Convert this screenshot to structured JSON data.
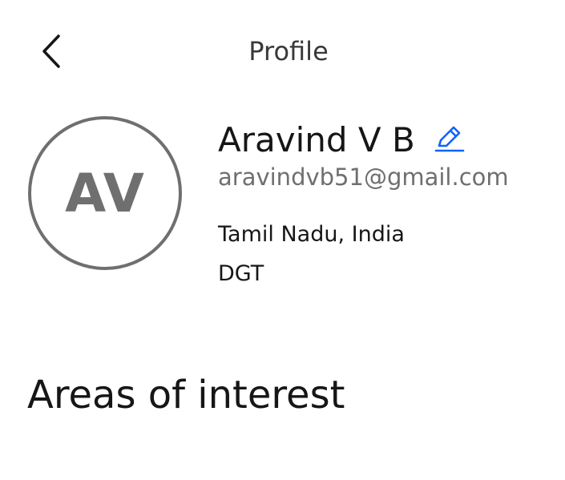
{
  "header": {
    "title": "Profile",
    "back_icon": "chevron-left-icon"
  },
  "profile": {
    "avatar_initials": "AV",
    "name": "Aravind V B",
    "edit_icon": "pencil-icon",
    "email": "aravindvb51@gmail.com",
    "location": "Tamil Nadu, India",
    "organization": "DGT"
  },
  "sections": {
    "areas_of_interest": "Areas of interest"
  },
  "colors": {
    "accent": "#0f62fe",
    "text_primary": "#161616",
    "text_secondary": "#6f6f6f",
    "avatar_border": "#6f6f6f",
    "background": "#ffffff"
  }
}
